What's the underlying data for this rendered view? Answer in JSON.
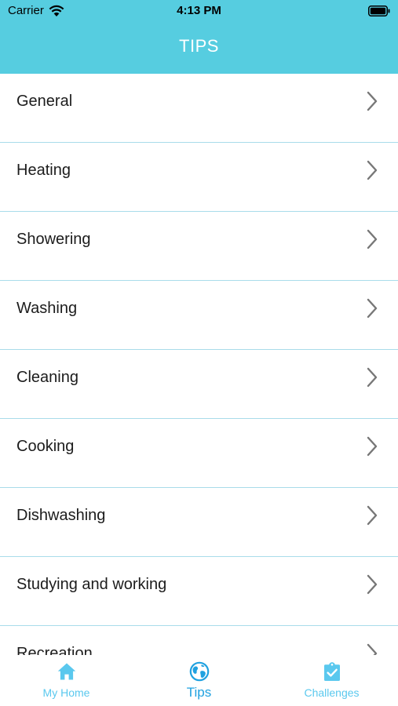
{
  "status_bar": {
    "carrier": "Carrier",
    "time": "4:13 PM"
  },
  "header": {
    "title": "TIPS"
  },
  "list": {
    "items": [
      {
        "label": "General"
      },
      {
        "label": "Heating"
      },
      {
        "label": "Showering"
      },
      {
        "label": "Washing"
      },
      {
        "label": "Cleaning"
      },
      {
        "label": "Cooking"
      },
      {
        "label": "Dishwashing"
      },
      {
        "label": "Studying and working"
      },
      {
        "label": "Recreation"
      }
    ]
  },
  "tabbar": {
    "tabs": [
      {
        "label": "My Home",
        "icon": "home-icon"
      },
      {
        "label": "Tips",
        "icon": "globe-icon",
        "active": true
      },
      {
        "label": "Challenges",
        "icon": "clipboard-check-icon"
      }
    ]
  },
  "colors": {
    "header_bg": "#56cde0",
    "divider": "#a9dcea",
    "tab_inactive": "#5ac8ee",
    "tab_active": "#1fa1e0"
  }
}
